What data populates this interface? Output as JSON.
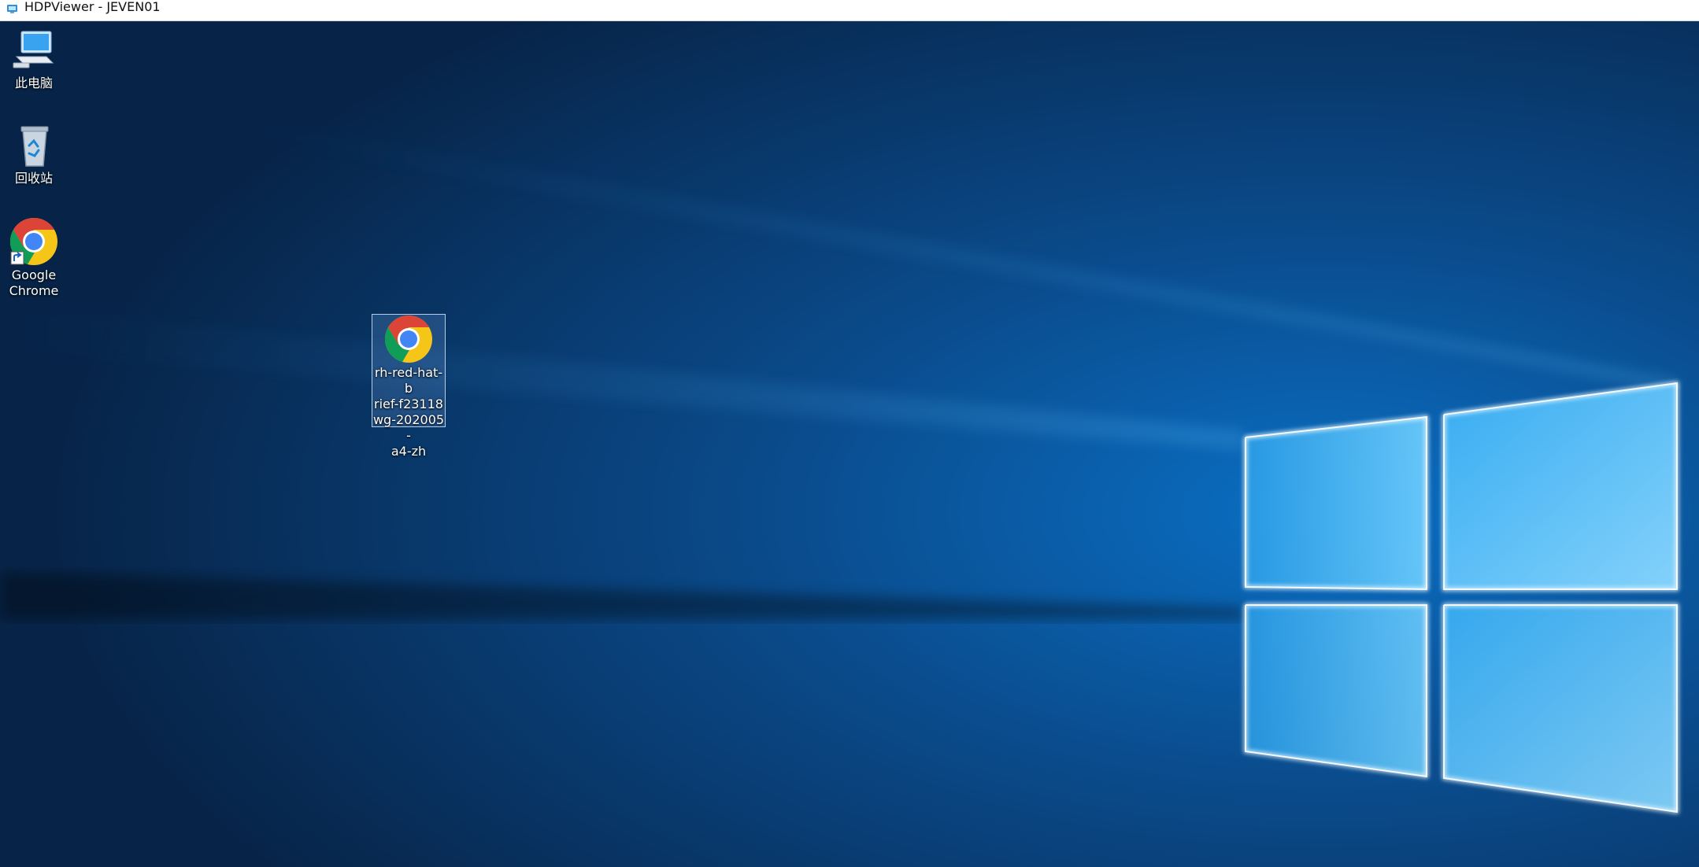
{
  "window": {
    "title": "HDPViewer - JEVEN01"
  },
  "desktop": {
    "icons": [
      {
        "label": "此电脑",
        "icon": "computer-icon"
      },
      {
        "label": "回收站",
        "icon": "recycle-bin-icon"
      },
      {
        "label_line1": "Google",
        "label_line2": "Chrome",
        "icon": "chrome-icon",
        "shortcut": true
      },
      {
        "label_lines": [
          "rh-red-hat-b",
          "rief-f23118",
          "wg-202005-",
          "a4-zh"
        ],
        "icon": "chrome-icon",
        "selected": true
      }
    ]
  },
  "colors": {
    "wallpaper_dark": "#0a2547",
    "wallpaper_light": "#5cc8ff",
    "titlebar": "#ffffff"
  }
}
